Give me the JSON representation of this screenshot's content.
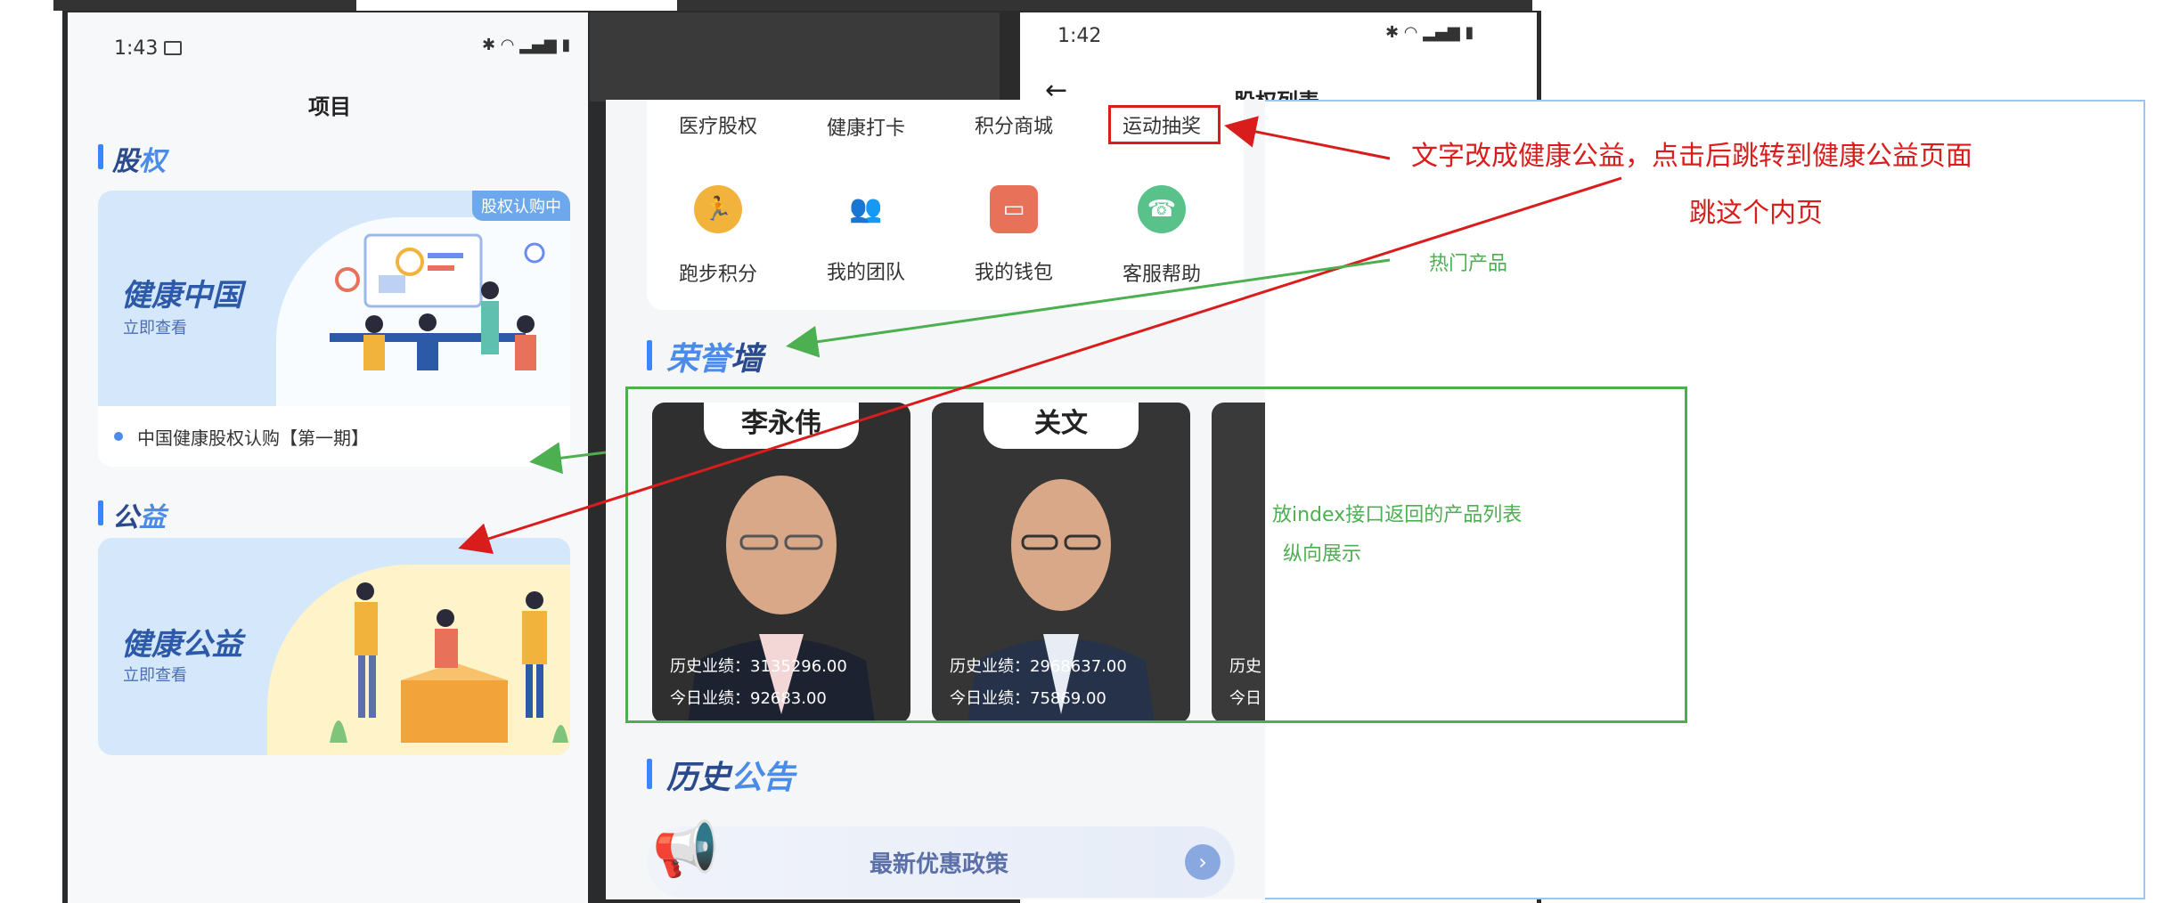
{
  "left_phone": {
    "status_time": "1:43",
    "title": "项目",
    "equity": {
      "section_title_a": "股",
      "section_title_b": "权",
      "card_tag": "股权认购中",
      "banner_title": "健康中国",
      "banner_sub": "立即查看",
      "item": "中国健康股权认购【第一期】"
    },
    "welfare": {
      "section_title_a": "公",
      "section_title_b": "益",
      "banner_title": "健康公益",
      "banner_sub": "立即查看"
    }
  },
  "right_phone": {
    "status_time": "1:42",
    "title": "股权列表"
  },
  "panel": {
    "grid_row1": [
      "医疗股权",
      "健康打卡",
      "积分商城",
      "运动抽奖"
    ],
    "grid_row2": [
      {
        "label": "跑步积分",
        "icon": "running-icon",
        "color": "#f2b33d"
      },
      {
        "label": "我的团队",
        "icon": "team-icon",
        "color": "#6c8df0"
      },
      {
        "label": "我的钱包",
        "icon": "wallet-icon",
        "color": "#e8715a"
      },
      {
        "label": "客服帮助",
        "icon": "support-icon",
        "color": "#59c28a"
      }
    ],
    "honor_a": "荣誉",
    "honor_b": "墙",
    "persons": [
      {
        "name": "李永伟",
        "hist_label": "历史业绩：",
        "hist": "3135296.00",
        "today_label": "今日业绩：",
        "today": "92683.00"
      },
      {
        "name": "关文",
        "hist_label": "历史业绩：",
        "hist": "2968637.00",
        "today_label": "今日业绩：",
        "today": "75869.00"
      },
      {
        "name": "",
        "hist_label": "历史",
        "hist": "",
        "today_label": "今日",
        "today": ""
      }
    ],
    "history_a": "历史",
    "history_b": "公告",
    "notice": "最新优惠政策"
  },
  "annotations": {
    "red1": "文字改成健康公益，点击后跳转到健康公益页面",
    "red2": "跳这个内页",
    "green1": "热门产品",
    "green2": "放index接口返回的产品列表",
    "green3": "纵向展示"
  },
  "colors": {
    "accent": "#3a86ff",
    "red": "#d91c1c",
    "green": "#4caf50"
  }
}
